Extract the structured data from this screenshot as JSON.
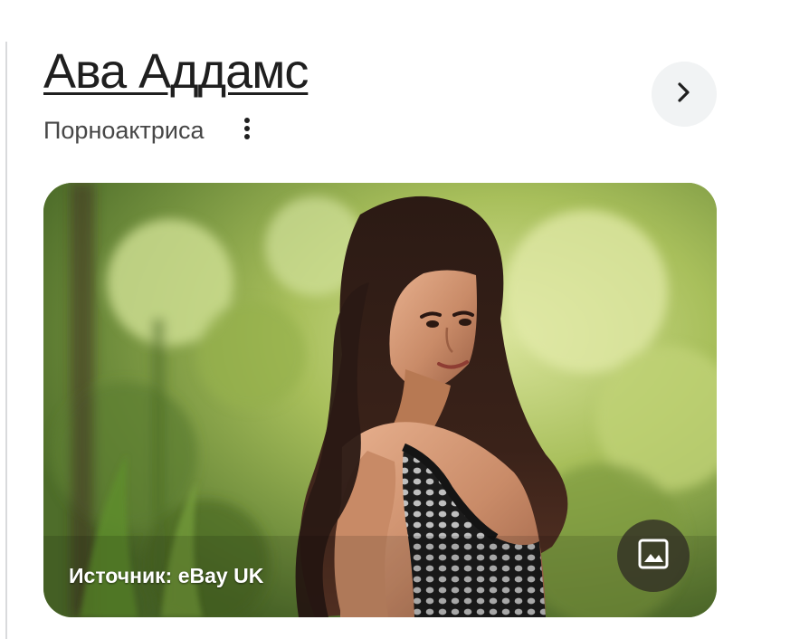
{
  "entity": {
    "title": "Ава Аддамс",
    "subtitle": "Порноактриса"
  },
  "actions": {
    "more_icon": "more-vert-icon",
    "next_icon": "chevron-right-icon",
    "image_icon": "image-icon"
  },
  "media": {
    "source_caption": "Источник: eBay UK"
  },
  "colors": {
    "title": "#1f1f1f",
    "subtitle": "#474747",
    "next_button_bg": "#f1f3f4",
    "image_button_bg": "#302c24"
  }
}
